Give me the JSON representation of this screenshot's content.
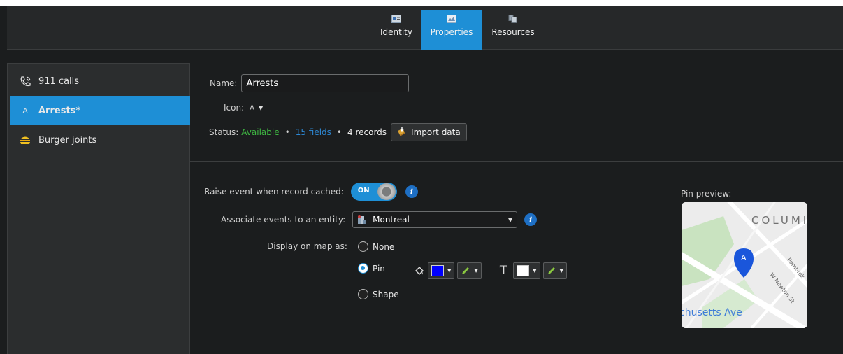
{
  "tabs": [
    {
      "label": "Identity",
      "icon": "identity-card-icon",
      "active": false
    },
    {
      "label": "Properties",
      "icon": "properties-icon",
      "active": true
    },
    {
      "label": "Resources",
      "icon": "resources-icon",
      "active": false
    }
  ],
  "sidebar": {
    "items": [
      {
        "label": "911 calls",
        "icon": "phone-icon",
        "active": false
      },
      {
        "label": "Arrests*",
        "icon_text": "A",
        "active": true
      },
      {
        "label": "Burger joints",
        "icon": "burger-icon",
        "active": false
      }
    ]
  },
  "form": {
    "name_label": "Name:",
    "name_value": "Arrests",
    "icon_label": "Icon:",
    "icon_value": "A",
    "status_label": "Status:",
    "status_value": "Available",
    "fields_link": "15 fields",
    "records": "4 records",
    "import_button": "Import data"
  },
  "events": {
    "raise_label": "Raise event when record cached:",
    "toggle_state": "ON",
    "associate_label": "Associate events to an entity:",
    "entity_value": "Montreal",
    "display_label": "Display on map as:",
    "options": [
      "None",
      "Pin",
      "Shape"
    ],
    "selected_option": "Pin",
    "text_glyph": "T"
  },
  "preview": {
    "label": "Pin preview:",
    "pin_letter": "A",
    "map_text_col": "COLUMI",
    "map_text_ave": "chusetts Ave",
    "map_text_st": "W Newton St",
    "map_text_pem": "Pembrok"
  },
  "colors": {
    "accent": "#1e8fd6",
    "status_available": "#3fba43",
    "link": "#2d89d6",
    "pin_fill": "#0000ff",
    "text_fill": "#ffffff",
    "map_pin": "#1a56db"
  }
}
